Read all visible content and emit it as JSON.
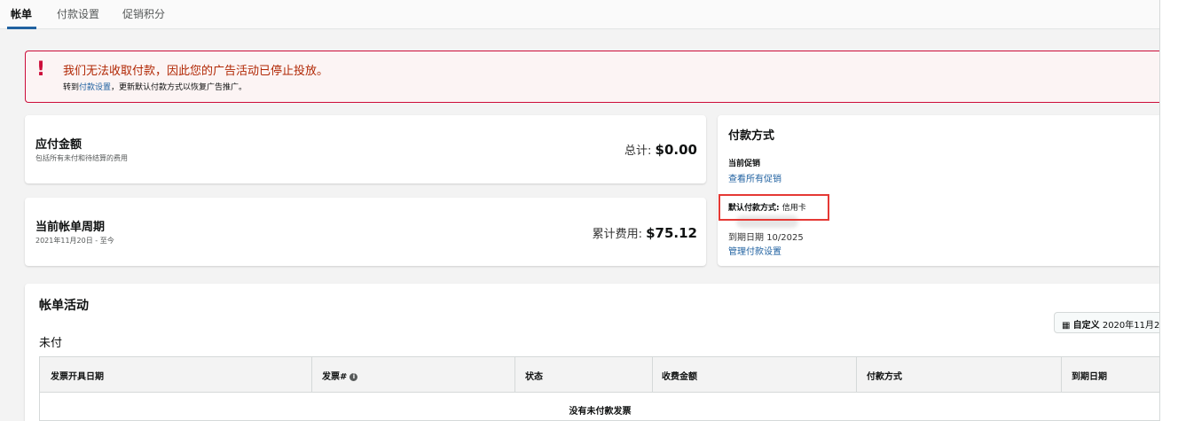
{
  "tabs": [
    {
      "label": "帐单"
    },
    {
      "label": "付款设置"
    },
    {
      "label": "促销积分"
    }
  ],
  "alert": {
    "icon": "!",
    "title": "我们无法收取付款，因此您的广告活动已停止投放。",
    "body_prefix": "转到",
    "body_link": "付款设置",
    "body_suffix": "，更新默认付款方式以恢复广告推广。"
  },
  "amount_due": {
    "title": "应付金额",
    "subtitle": "包括所有未付和待结算的费用",
    "total_label": "总计:",
    "total_value": "$0.00"
  },
  "billing_cycle": {
    "title": "当前帐单周期",
    "subtitle": "2021年11月20日 - 至今",
    "accrued_label": "累计费用:",
    "accrued_value": "$75.12"
  },
  "payment_method": {
    "title": "付款方式",
    "promo_label": "当前促销",
    "promo_link": "查看所有促销",
    "default_label": "默认付款方式:",
    "default_value": "信用卡",
    "expiry_label": "到期日期",
    "expiry_value": "10/2025",
    "manage_link": "管理付款设置"
  },
  "activity": {
    "title": "帐单活动",
    "unpaid_label": "未付",
    "date_filter_label": "自定义",
    "date_filter_value": "2020年11月2",
    "columns": [
      "发票开具日期",
      "发票#",
      "状态",
      "收费金额",
      "付款方式",
      "到期日期"
    ],
    "empty_text": "没有未付款发票"
  },
  "colors": {
    "accent": "#2162a1",
    "alert_red": "#cc0c39",
    "highlight": "#e53935"
  }
}
